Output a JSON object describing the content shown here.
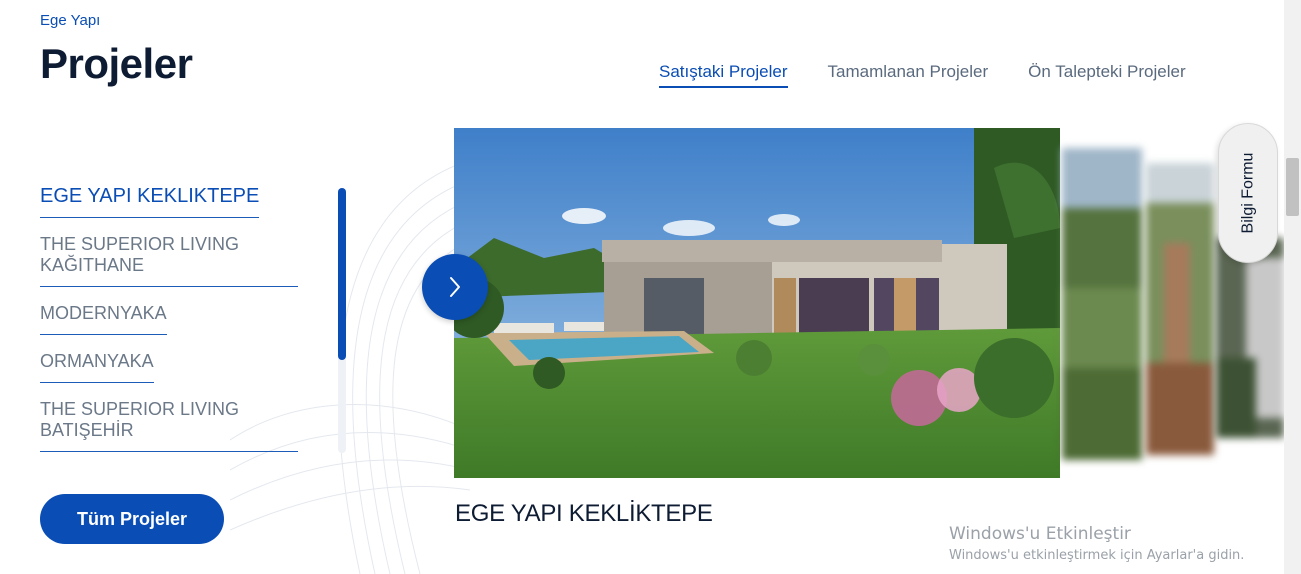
{
  "brand": "Ege Yapı",
  "title": "Projeler",
  "tabs": [
    {
      "label": "Satıştaki Projeler",
      "active": true
    },
    {
      "label": "Tamamlanan Projeler",
      "active": false
    },
    {
      "label": "Ön Talepteki Projeler",
      "active": false
    }
  ],
  "projects": [
    "EGE YAPI KEKLİKTEPE",
    "THE SUPERIOR LIVING KAĞITHANE",
    "MODERNYAKA",
    "ORMANYAKA",
    "THE SUPERIOR LIVING BATIŞEHİR"
  ],
  "all_projects_label": "Tüm Projeler",
  "caption": "EGE YAPI KEKLİKTEPE",
  "info_form_label": "Bilgi Formu",
  "next_icon": "chevron-right-icon",
  "accent_color": "#0a4db5",
  "watermark": {
    "title": "Windows'u Etkinleştir",
    "subtitle": "Windows'u etkinleştirmek için Ayarlar'a gidin."
  }
}
